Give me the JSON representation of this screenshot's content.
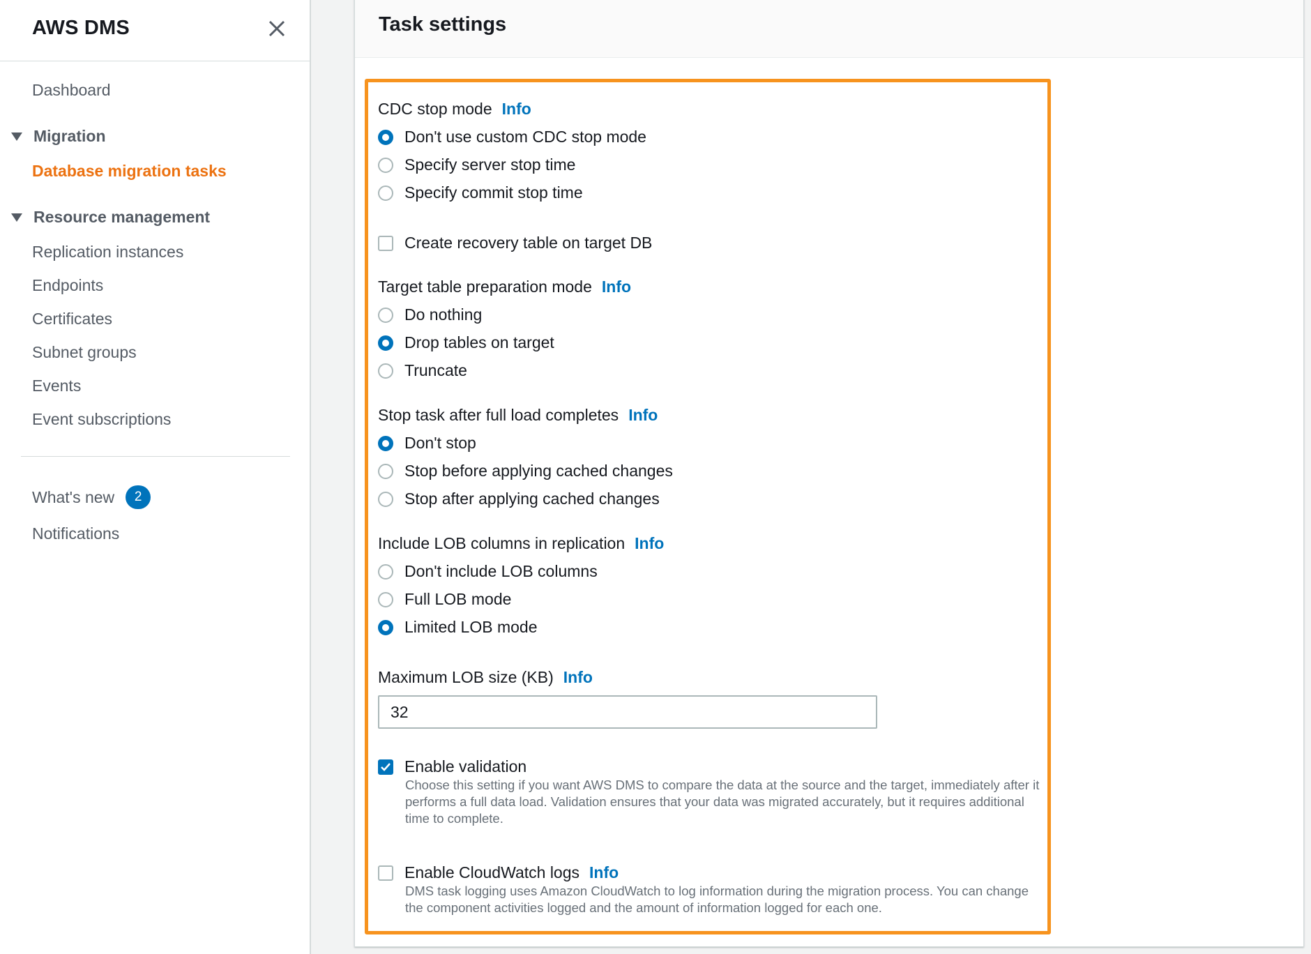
{
  "sidebar": {
    "title": "AWS DMS",
    "dashboard": "Dashboard",
    "migration_section": "Migration",
    "migration_items": [
      "Database migration tasks"
    ],
    "resource_section": "Resource management",
    "resource_items": [
      "Replication instances",
      "Endpoints",
      "Certificates",
      "Subnet groups",
      "Events",
      "Event subscriptions"
    ],
    "whats_new": "What's new",
    "whats_new_badge": "2",
    "notifications": "Notifications"
  },
  "panel": {
    "title": "Task settings"
  },
  "form": {
    "info_label": "Info",
    "cdc_stop_mode": {
      "label": "CDC stop mode",
      "options": [
        "Don't use custom CDC stop mode",
        "Specify server stop time",
        "Specify commit stop time"
      ],
      "selected": 0
    },
    "recovery_table": {
      "label": "Create recovery table on target DB",
      "checked": false
    },
    "target_prep_mode": {
      "label": "Target table preparation mode",
      "options": [
        "Do nothing",
        "Drop tables on target",
        "Truncate"
      ],
      "selected": 1
    },
    "stop_after_full_load": {
      "label": "Stop task after full load completes",
      "options": [
        "Don't stop",
        "Stop before applying cached changes",
        "Stop after applying cached changes"
      ],
      "selected": 0
    },
    "lob_columns": {
      "label": "Include LOB columns in replication",
      "options": [
        "Don't include LOB columns",
        "Full LOB mode",
        "Limited LOB mode"
      ],
      "selected": 2
    },
    "max_lob_size": {
      "label": "Maximum LOB size (KB)",
      "value": "32"
    },
    "enable_validation": {
      "label": "Enable validation",
      "checked": true,
      "description": "Choose this setting if you want AWS DMS to compare the data at the source and the target, immediately after it performs a full data load. Validation ensures that your data was migrated accurately, but it requires additional time to complete."
    },
    "cloudwatch_logs": {
      "label": "Enable CloudWatch logs",
      "checked": false,
      "description": "DMS task logging uses Amazon CloudWatch to log information during the migration process. You can change the component activities logged and the amount of information logged for each one."
    }
  },
  "colors": {
    "accent_active": "#ec7211",
    "link": "#0073bb",
    "highlight_border": "#f7931e"
  }
}
